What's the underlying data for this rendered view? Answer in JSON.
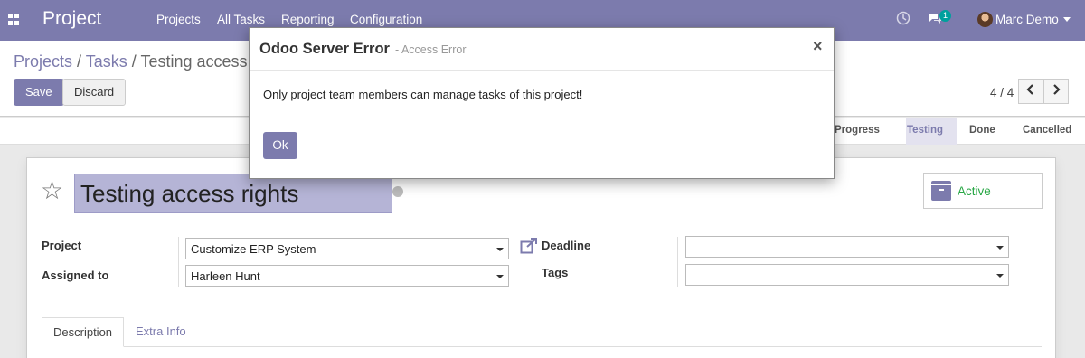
{
  "navbar": {
    "brand": "Project",
    "menu": [
      "Projects",
      "All Tasks",
      "Reporting",
      "Configuration"
    ],
    "messages_count": "1",
    "user_name": "Marc Demo"
  },
  "breadcrumb": {
    "root": "Projects",
    "mid": "Tasks",
    "current": "Testing access rights"
  },
  "buttons": {
    "save": "Save",
    "discard": "Discard"
  },
  "pager": {
    "value": "4 / 4",
    "prev_icon": "chevron-left-icon",
    "next_icon": "chevron-right-icon"
  },
  "stages": [
    "Progress",
    "Testing",
    "Done",
    "Cancelled"
  ],
  "stages_active": "Testing",
  "record": {
    "title": "Testing access rights",
    "active_label": "Active",
    "project_label": "Project",
    "project_value": "Customize ERP System",
    "assigned_label": "Assigned to",
    "assigned_value": "Harleen Hunt",
    "deadline_label": "Deadline",
    "deadline_value": "",
    "tags_label": "Tags",
    "tags_value": ""
  },
  "tabs": [
    "Description",
    "Extra Info"
  ],
  "modal": {
    "title": "Odoo Server Error",
    "subtitle": "- Access Error",
    "close": "×",
    "message": "Only project team members can manage tasks of this project!",
    "ok": "Ok"
  },
  "colors": {
    "brand": "#7c7bad",
    "active_green": "#28a745",
    "badge": "#00a09d"
  }
}
